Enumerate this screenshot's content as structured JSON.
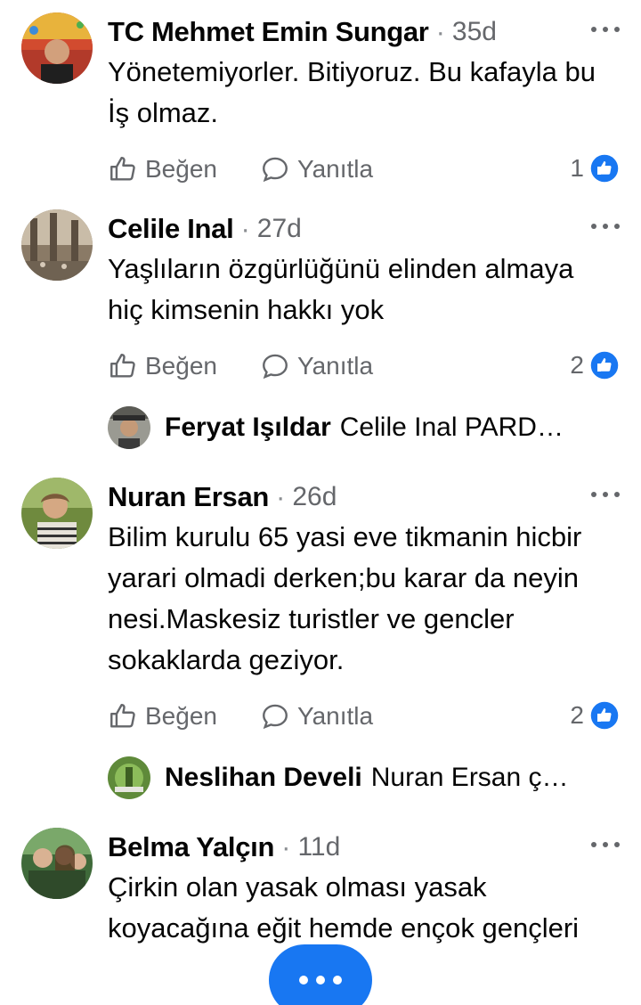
{
  "comments": [
    {
      "name": "TC Mehmet Emin Sungar",
      "time": "35d",
      "text": "Yönetemiyorler. Bitiyoruz. Bu kafayla bu İş olmaz.",
      "like_label": "Beğen",
      "reply_label": "Yanıtla",
      "reaction_count": "1"
    },
    {
      "name": "Celile Inal",
      "time": "27d",
      "text": "Yaşlıların özgürlüğünü elinden almaya hiç kimsenin hakkı yok",
      "like_label": "Beğen",
      "reply_label": "Yanıtla",
      "reaction_count": "2",
      "reply_preview": {
        "name": "Feryat Işıldar",
        "text": "Celile Inal  PARD…"
      }
    },
    {
      "name": "Nuran Ersan",
      "time": "26d",
      "text": "Bilim kurulu  65 yasi eve tikmanin hicbir yarari olmadi derken;bu karar da neyin nesi.Maskesiz turistler ve gencler sokaklarda geziyor.",
      "like_label": "Beğen",
      "reply_label": "Yanıtla",
      "reaction_count": "2",
      "reply_preview": {
        "name": "Neslihan Develi",
        "text": "Nuran Ersan ç…"
      }
    },
    {
      "name": "Belma Yalçın",
      "time": "11d",
      "text": "Çirkin olan yasak olması yasak koyacağına eğit hemde ençok gençleri"
    }
  ],
  "separator": "·",
  "colors": {
    "accent": "#1877f2",
    "secondary_text": "#65676b"
  }
}
